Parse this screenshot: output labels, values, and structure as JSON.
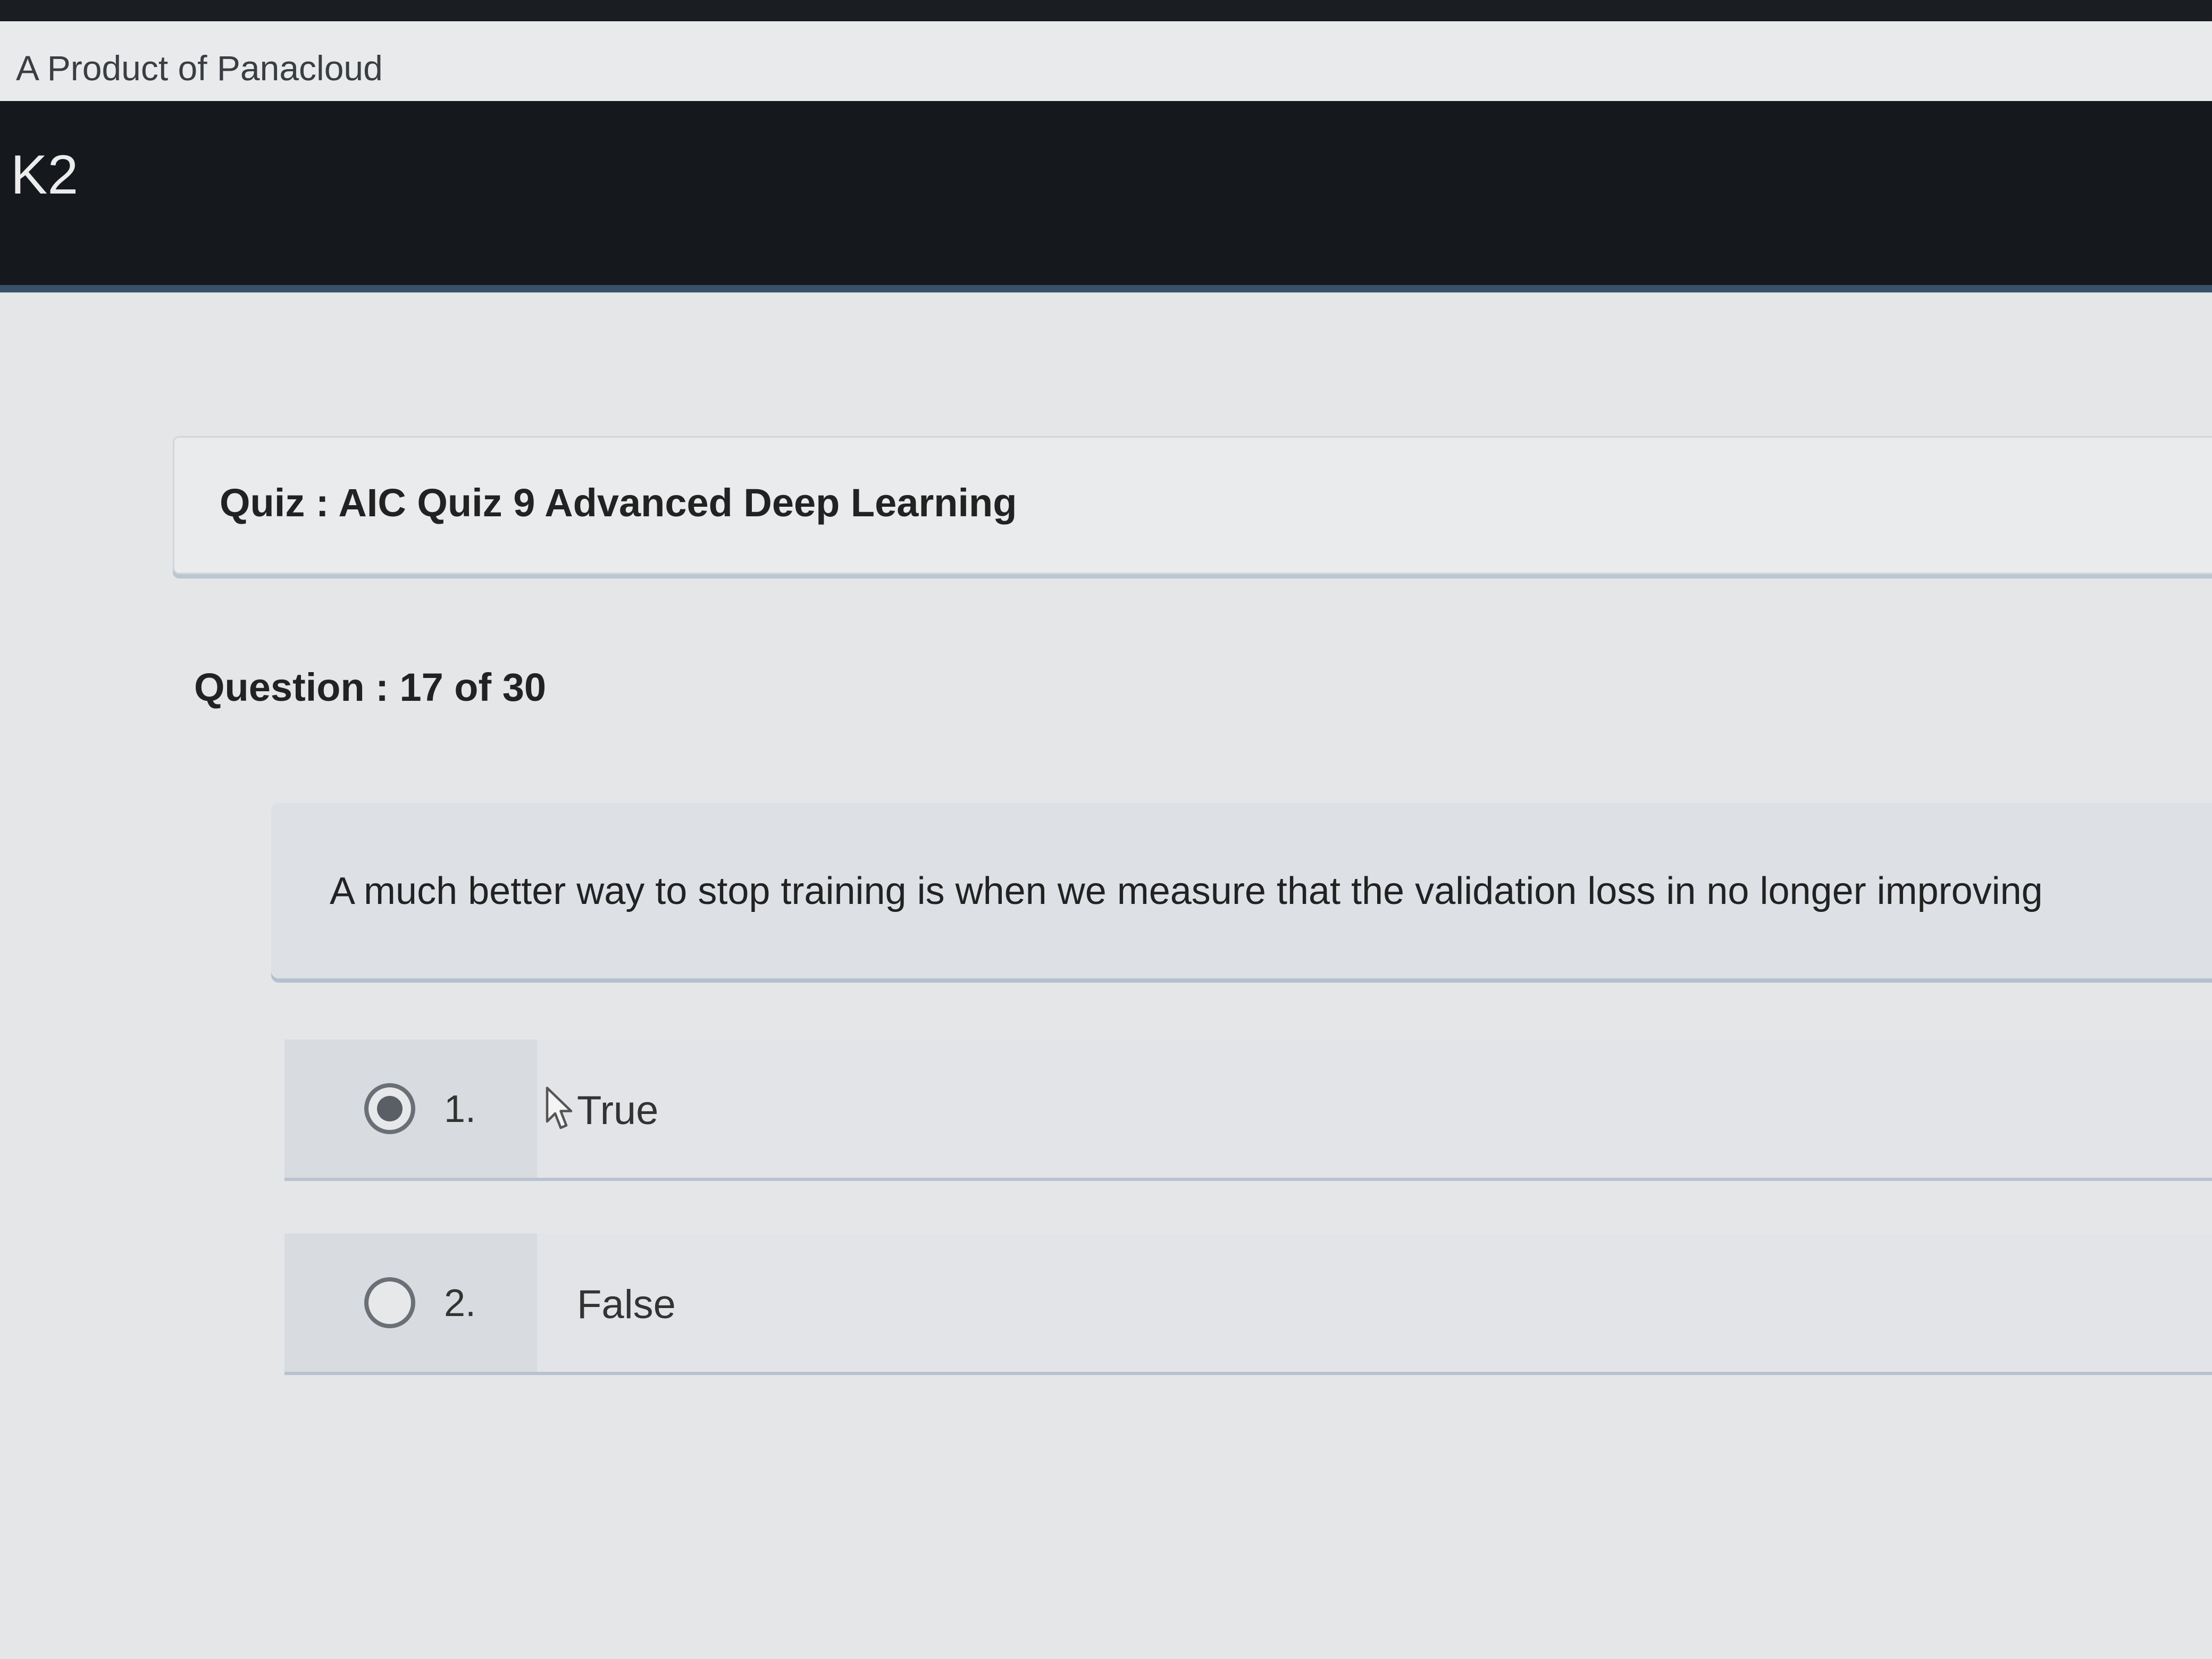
{
  "product": {
    "tagline": "A Product of Panacloud"
  },
  "header": {
    "brand": "K2"
  },
  "quiz": {
    "title": "Quiz : AIC Quiz 9 Advanced Deep Learning",
    "question_counter": "Question : 17 of 30",
    "question_text": "A much better way to stop training is when we measure that the validation loss in no longer improving",
    "options": [
      {
        "number": "1.",
        "label": "True",
        "selected": true
      },
      {
        "number": "2.",
        "label": "False",
        "selected": false
      }
    ]
  },
  "colors": {
    "header_bg": "#15181d",
    "page_bg": "#e4e6e8",
    "accent_border": "#39526b"
  },
  "icons": {
    "cursor": "mouse-pointer-icon",
    "radio_selected": "radio-selected-icon",
    "radio_unselected": "radio-unselected-icon"
  }
}
